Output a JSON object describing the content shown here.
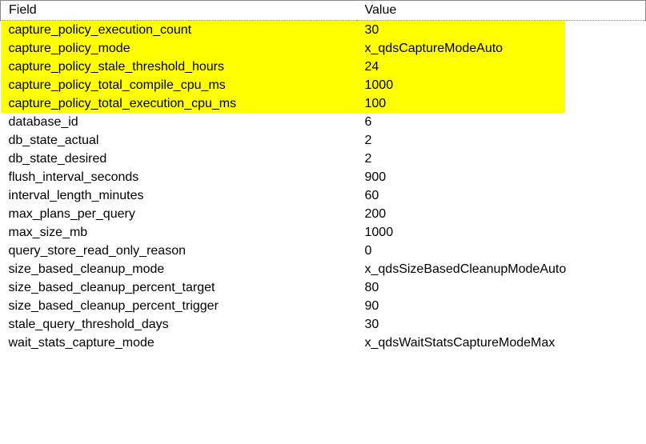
{
  "columns": {
    "field": "Field",
    "value": "Value"
  },
  "rows": [
    {
      "field": "capture_policy_execution_count",
      "value": "30",
      "highlight": true
    },
    {
      "field": "capture_policy_mode",
      "value": "x_qdsCaptureModeAuto",
      "highlight": true
    },
    {
      "field": "capture_policy_stale_threshold_hours",
      "value": "24",
      "highlight": true
    },
    {
      "field": "capture_policy_total_compile_cpu_ms",
      "value": "1000",
      "highlight": true
    },
    {
      "field": "capture_policy_total_execution_cpu_ms",
      "value": "100",
      "highlight": true
    },
    {
      "field": "database_id",
      "value": "6",
      "highlight": false
    },
    {
      "field": "db_state_actual",
      "value": "2",
      "highlight": false
    },
    {
      "field": "db_state_desired",
      "value": "2",
      "highlight": false
    },
    {
      "field": "flush_interval_seconds",
      "value": "900",
      "highlight": false
    },
    {
      "field": "interval_length_minutes",
      "value": "60",
      "highlight": false
    },
    {
      "field": "max_plans_per_query",
      "value": "200",
      "highlight": false
    },
    {
      "field": "max_size_mb",
      "value": "1000",
      "highlight": false
    },
    {
      "field": "query_store_read_only_reason",
      "value": "0",
      "highlight": false
    },
    {
      "field": "size_based_cleanup_mode",
      "value": "x_qdsSizeBasedCleanupModeAuto",
      "highlight": false
    },
    {
      "field": "size_based_cleanup_percent_target",
      "value": "80",
      "highlight": false
    },
    {
      "field": "size_based_cleanup_percent_trigger",
      "value": "90",
      "highlight": false
    },
    {
      "field": "stale_query_threshold_days",
      "value": "30",
      "highlight": false
    },
    {
      "field": "wait_stats_capture_mode",
      "value": "x_qdsWaitStatsCaptureModeMax",
      "highlight": false
    }
  ]
}
